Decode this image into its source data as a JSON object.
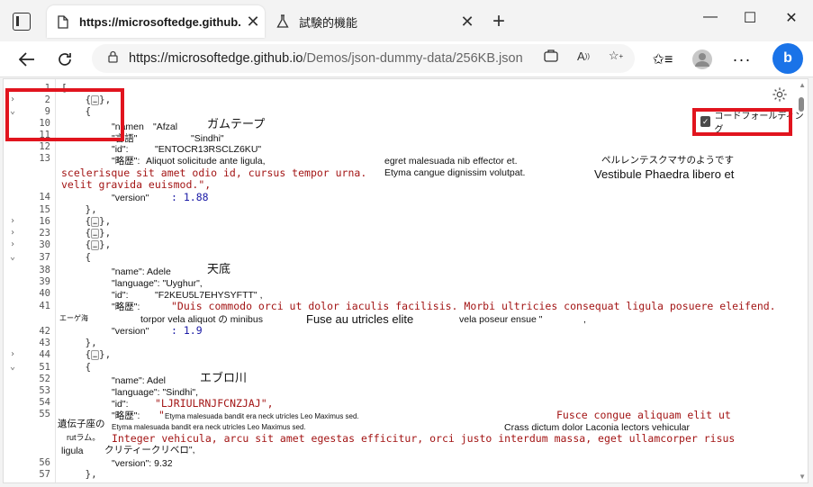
{
  "tabs": [
    {
      "title": "https://microsoftedge.github.io",
      "active": true
    },
    {
      "title": "試験的機能",
      "active": false
    }
  ],
  "address": {
    "host": "https://microsoftedge.github.io",
    "path": "/Demos/json-dummy-data/256KB.json"
  },
  "fold_option": "コードフォールディング",
  "colors": {
    "string": "#a31515",
    "number": "#1a1aa6",
    "highlight": "#e1141e"
  },
  "lines": [
    {
      "n": "1",
      "code": "["
    },
    {
      "n": "2",
      "fold": "›",
      "code": "    {",
      "collapsed": true,
      "after": "},"
    },
    {
      "n": "9",
      "fold": "⌄",
      "code": "    {"
    },
    {
      "n": "10",
      "code": ""
    },
    {
      "n": "11",
      "code": ""
    },
    {
      "n": "12",
      "code": ""
    },
    {
      "n": "13",
      "code": ""
    },
    {
      "n": "",
      "code": ""
    },
    {
      "n": "",
      "code": ""
    },
    {
      "n": "14",
      "code": ""
    },
    {
      "n": "15",
      "code": "    },"
    },
    {
      "n": "16",
      "fold": "›",
      "code": "    {",
      "collapsed": true,
      "after": "},"
    },
    {
      "n": "23",
      "fold": "›",
      "code": "    {",
      "collapsed": true,
      "after": "},"
    },
    {
      "n": "30",
      "fold": "›",
      "code": "    {",
      "collapsed": true,
      "after": "},"
    },
    {
      "n": "37",
      "fold": "⌄",
      "code": "    {"
    },
    {
      "n": "38",
      "code": ""
    },
    {
      "n": "39",
      "code": ""
    },
    {
      "n": "40",
      "code": ""
    },
    {
      "n": "41",
      "code": ""
    },
    {
      "n": "",
      "code": ""
    },
    {
      "n": "42",
      "code": ""
    },
    {
      "n": "43",
      "code": "    },"
    },
    {
      "n": "44",
      "fold": "›",
      "code": "    {",
      "collapsed": true,
      "after": "},"
    },
    {
      "n": "51",
      "fold": "⌄",
      "code": "    {"
    },
    {
      "n": "52",
      "code": ""
    },
    {
      "n": "53",
      "code": ""
    },
    {
      "n": "54",
      "code": ""
    },
    {
      "n": "55",
      "code": ""
    },
    {
      "n": "",
      "code": ""
    },
    {
      "n": "",
      "code": ""
    },
    {
      "n": "",
      "code": ""
    },
    {
      "n": "56",
      "code": ""
    },
    {
      "n": "57",
      "code": "    },"
    }
  ],
  "overlays": {
    "o1": "\"namen",
    "o1b": "\"Afzal",
    "o2": "ガムテープ",
    "o3": "\"言語\"",
    "o4": "\"Sindhi\"",
    "o5": "\"id\":",
    "o6": "\"ENTOCR13RSCLZ6KU\"",
    "o7": "\"略歴\":",
    "o8": "Aliquot solicitude ante ligula,",
    "o9": "egret malesuada nib effector et.",
    "o10": "ペルレンテスクマサのようです",
    "o11": "scelerisque sit amet odio id, cursus tempor urna.",
    "o12": "Etyma cangue dignissim volutpat.",
    "o13": "Vestibule Phaedra libero et",
    "o14": "velit gravida euismod.\",",
    "o15": "\"version\"",
    "o16": ": 1.88",
    "p1": "\"name\": Adele",
    "p2": "天底",
    "p3": "\"language\": \"Uyghur\",",
    "p4": "\"id\":",
    "p5": "\"F2KEU5L7EHYSYFTT\" ,",
    "p6": "\"略歴\":",
    "p7": "\"Duis commodo orci ut dolor iaculis facilisis. Morbi ultricies consequat ligula posuere eleifend.",
    "p8": "エーゲ海",
    "p9": "torpor vela aliquot の minibus",
    "p10": "Fuse au utricles elite",
    "p11": "vela poseur ensue \"",
    "p12": ",",
    "p13": "\"version\"",
    "p14": ": 1.9",
    "q1": "\"name\": Adel",
    "q2": "エブロ川",
    "q3": "\"language\": \"Sindhi\",",
    "q4": "\"id\":",
    "q5": "\"LJRIULRNJFCNZJAJ\",",
    "q6": "\"略歴\":",
    "q7": "\"",
    "q8": "Etyma malesuada bandit era neck utricles Leo Maximus sed.",
    "q9": "Fusce congue aliquam elit ut",
    "q10": "遺伝子座の",
    "q11": "Etyma malesuada bandit era neck utricles Leo Maximus sed.",
    "q12": "Crass dictum dolor Laconia lectors vehicular",
    "q13": "rutラム。",
    "q14": "Integer vehicula, arcu sit amet egestas efficitur, orci justo interdum massa, eget ullamcorper risus",
    "q15": "ligula",
    "q16": "クリティークリベロ\",",
    "q17": "\"version\": 9.32"
  }
}
